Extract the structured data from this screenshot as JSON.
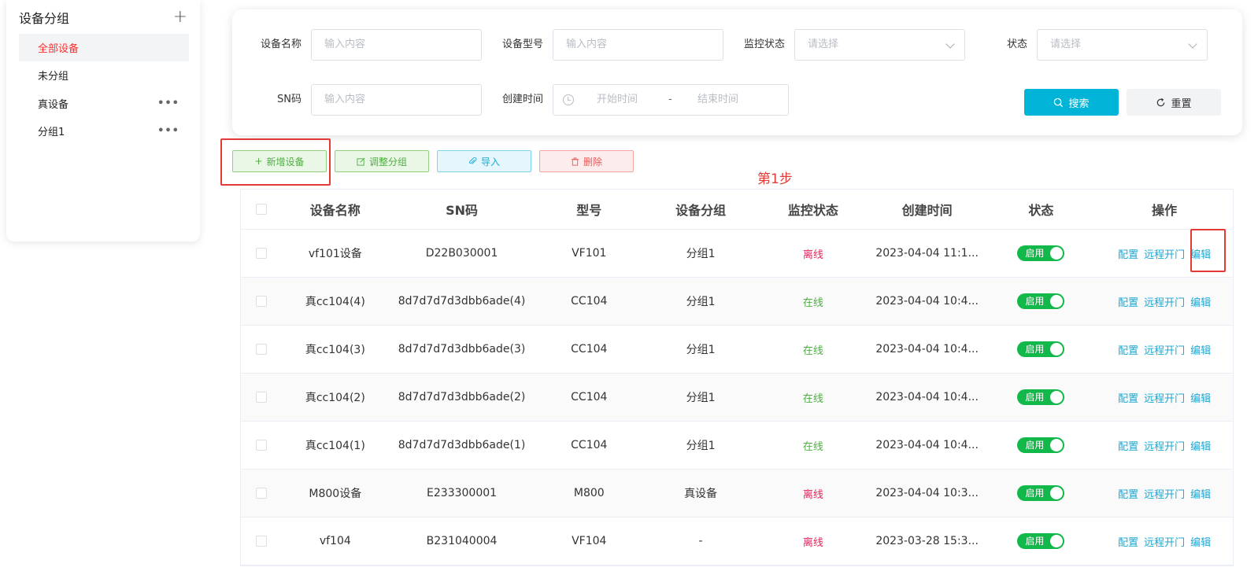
{
  "sidebar": {
    "title": "设备分组",
    "add_icon": "plus-icon",
    "items": [
      {
        "label": "全部设备",
        "active": true
      },
      {
        "label": "未分组"
      },
      {
        "label": "真设备",
        "more": "•••"
      },
      {
        "label": "分组1",
        "more": "•••"
      }
    ]
  },
  "filter": {
    "device_name_label": "设备名称",
    "device_name_placeholder": "输入内容",
    "model_label": "设备型号",
    "model_placeholder": "输入内容",
    "monitor_label": "监控状态",
    "monitor_placeholder": "请选择",
    "status_label": "状态",
    "status_placeholder": "请选择",
    "sn_label": "SN码",
    "sn_placeholder": "输入内容",
    "created_label": "创建时间",
    "start_placeholder": "开始时间",
    "date_sep": "-",
    "end_placeholder": "结束时间",
    "search_label": "搜索",
    "reset_label": "重置"
  },
  "actions": {
    "add": "新增设备",
    "adjust": "调整分组",
    "import": "导入",
    "delete": "删除"
  },
  "annotation": {
    "step": "第1步"
  },
  "colors": {
    "accent": "#00b4d8",
    "online": "#4caf3f",
    "offline": "#e8245a",
    "toggle": "#13b84a",
    "highlight": "#e53935"
  },
  "table": {
    "columns": [
      "设备名称",
      "SN码",
      "型号",
      "设备分组",
      "监控状态",
      "创建时间",
      "状态",
      "操作"
    ],
    "rows": [
      {
        "name": "vf101设备",
        "sn": "D22B030001",
        "model": "VF101",
        "group": "分组1",
        "monitor": "离线",
        "created": "2023-04-04 11:1...",
        "status": "启用"
      },
      {
        "name": "真cc104(4)",
        "sn": "8d7d7d7d3dbb6ade(4)",
        "model": "CC104",
        "group": "分组1",
        "monitor": "在线",
        "created": "2023-04-04 10:4...",
        "status": "启用"
      },
      {
        "name": "真cc104(3)",
        "sn": "8d7d7d7d3dbb6ade(3)",
        "model": "CC104",
        "group": "分组1",
        "monitor": "在线",
        "created": "2023-04-04 10:4...",
        "status": "启用"
      },
      {
        "name": "真cc104(2)",
        "sn": "8d7d7d7d3dbb6ade(2)",
        "model": "CC104",
        "group": "分组1",
        "monitor": "在线",
        "created": "2023-04-04 10:4...",
        "status": "启用"
      },
      {
        "name": "真cc104(1)",
        "sn": "8d7d7d7d3dbb6ade(1)",
        "model": "CC104",
        "group": "分组1",
        "monitor": "在线",
        "created": "2023-04-04 10:4...",
        "status": "启用"
      },
      {
        "name": "M800设备",
        "sn": "E233300001",
        "model": "M800",
        "group": "真设备",
        "monitor": "离线",
        "created": "2023-04-04 10:3...",
        "status": "启用"
      },
      {
        "name": "vf104",
        "sn": "B231040004",
        "model": "VF104",
        "group": "-",
        "monitor": "离线",
        "created": "2023-03-28 15:3...",
        "status": "启用"
      }
    ],
    "ops": {
      "config": "配置",
      "remote_open": "远程开门",
      "edit": "编辑"
    }
  }
}
